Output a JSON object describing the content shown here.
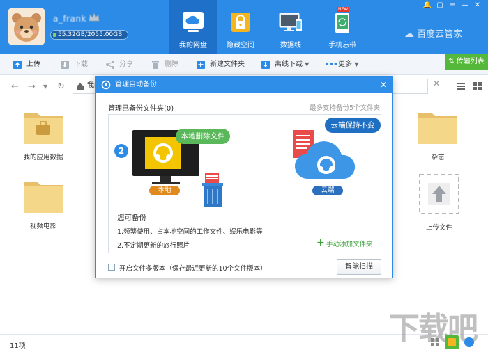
{
  "header": {
    "username": "a_frank",
    "quota": "55.32GB/2055.00GB",
    "brand": "百度云管家",
    "window_controls": [
      "🔔",
      "▢",
      "≡",
      "—",
      "✕"
    ],
    "tabs": [
      {
        "label": "我的网盘",
        "icon": "cloud-disk-icon"
      },
      {
        "label": "隐藏空间",
        "icon": "lock-icon"
      },
      {
        "label": "数据线",
        "icon": "monitor-icon"
      },
      {
        "label": "手机忘带",
        "icon": "phone-sync-icon",
        "badge": "NEW"
      }
    ]
  },
  "toolbar": {
    "upload": "上传",
    "download": "下载",
    "share": "分享",
    "delete": "删除",
    "new_folder": "新建文件夹",
    "offline_download": "离线下载",
    "more": "更多",
    "transfer_list": "传输列表"
  },
  "addressbar": {
    "path": "我的"
  },
  "files": [
    {
      "name": "我的应用数据",
      "icon": "briefcase-folder-icon"
    },
    {
      "name": "视频电影",
      "icon": "folder-icon"
    },
    {
      "name": "杂志",
      "icon": "folder-icon"
    },
    {
      "name": "上传文件",
      "icon": "upload-arrow-icon"
    }
  ],
  "status": {
    "count": "11项"
  },
  "watermark": "下载吧",
  "dialog": {
    "title": "管理自动备份",
    "close": "✕",
    "subtitle": "管理已备份文件夹(0)",
    "hint": "最多支持备份5个文件夹",
    "step": "2",
    "bubble_local": "本地删除文件",
    "bubble_cloud": "云端保持不变",
    "tag_local": "本地",
    "tag_cloud": "云端",
    "can_title": "您可备份",
    "items": [
      "1.频繁使用、占本地空间的工作文件、娱乐电影等",
      "2.不定期更新的旅行照片"
    ],
    "add_folder": "手动添加文件夹",
    "checkbox_label": "开启文件多版本（保存最近更新的10个文件版本）",
    "scan_button": "智能扫描"
  },
  "colors": {
    "header_bg": "#2b8be6",
    "accent_green": "#56b83a",
    "folder_yellow": "#f5d78a"
  }
}
